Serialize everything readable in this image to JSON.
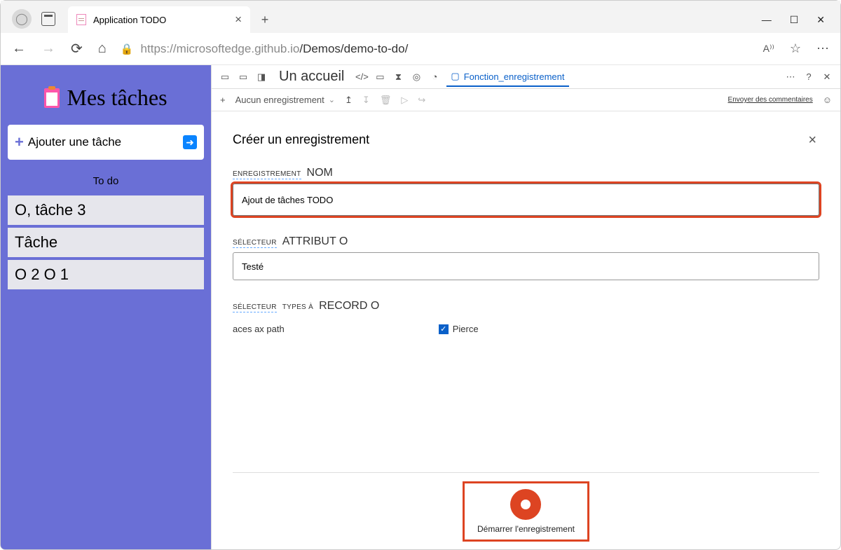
{
  "browser": {
    "tab_title": "Application TODO",
    "url_host": "https://microsoftedge.github.io",
    "url_path": "/Demos/demo-to-do/"
  },
  "app": {
    "title": "Mes tâches",
    "add_placeholder": "Ajouter une tâche",
    "section": "To do",
    "tasks": [
      "O, tâche 3",
      "Tâche",
      "O 2 O 1"
    ]
  },
  "devtools": {
    "welcome": "Un accueil",
    "active_tab": "Fonction_enregistrement",
    "no_recording": "Aucun enregistrement",
    "send_feedback": "Envoyer des commentaires",
    "panel_title": "Créer un enregistrement",
    "label_rec": "ENREGISTREMENT",
    "label_name": "NOM",
    "name_value": "Ajout de tâches TODO",
    "label_selector": "SÉLECTEUR",
    "label_attr": "ATTRIBUT O",
    "attr_value": "Testé",
    "label_types": "TYPES À",
    "label_record": "RECORD O",
    "check1": "aces ax path",
    "check2": "Pierce",
    "start_label": "Démarrer l'enregistrement"
  }
}
